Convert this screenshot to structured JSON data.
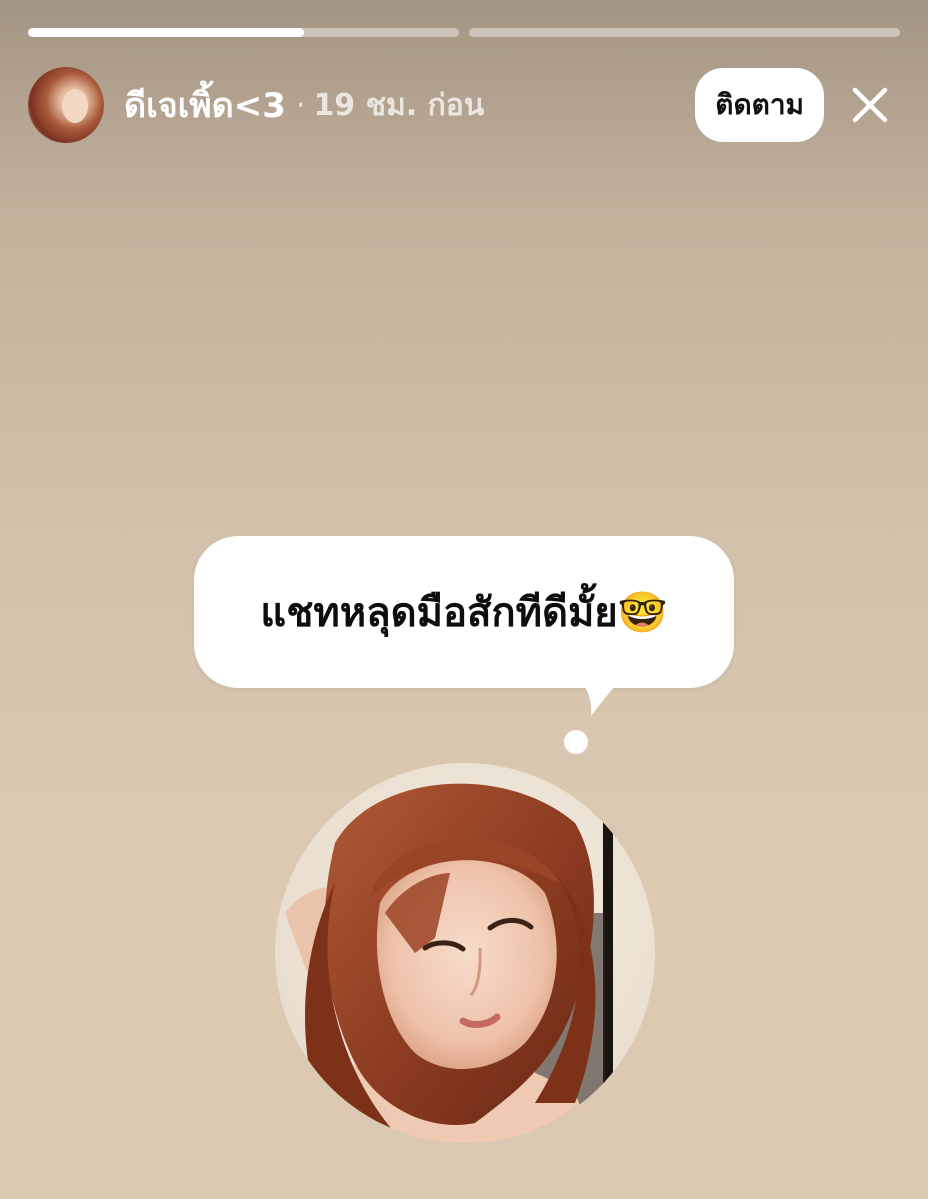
{
  "progress": {
    "segments": [
      {
        "fill": 0.64
      },
      {
        "fill": 0
      }
    ]
  },
  "header": {
    "username": "ดีเจเพิ้ด<3",
    "separator": "·",
    "time_ago": "19 ชม. ก่อน",
    "follow_label": "ติดตาม",
    "close_icon": "close-icon",
    "avatar_icon": "avatar"
  },
  "note": {
    "text": "แชทหลุดมือสักทีดีมั้ย🤓"
  },
  "colors": {
    "background_top": "#a39584",
    "background_bottom": "#dbc8b1",
    "bubble": "#ffffff",
    "text_dark": "#0e0e0e",
    "text_light": "#ffffff"
  }
}
